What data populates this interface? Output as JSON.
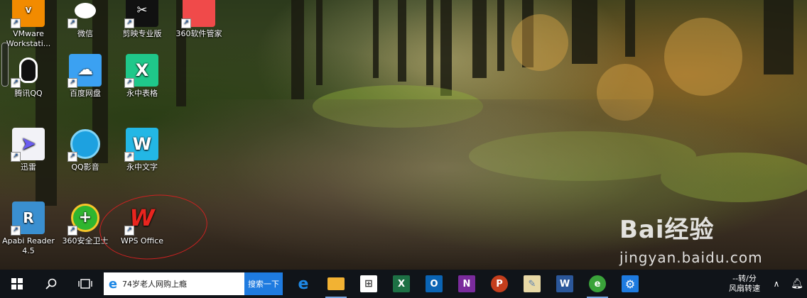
{
  "desktop_icons": [
    {
      "label": "VMware Workstati...",
      "icon": "vmware-icon"
    },
    {
      "label": "微信",
      "icon": "wechat-icon"
    },
    {
      "label": "剪映专业版",
      "icon": "jianying-icon"
    },
    {
      "label": "360软件管家",
      "icon": "360-software-manager-icon"
    },
    {
      "label": "腾讯QQ",
      "icon": "qq-icon"
    },
    {
      "label": "百度网盘",
      "icon": "baidu-netdisk-icon"
    },
    {
      "label": "永中表格",
      "icon": "yozo-sheet-icon"
    },
    {
      "label": "迅雷",
      "icon": "thunder-icon"
    },
    {
      "label": "QQ影音",
      "icon": "qq-player-icon"
    },
    {
      "label": "永中文字",
      "icon": "yozo-writer-icon"
    },
    {
      "label": "Apabi Reader 4.5",
      "icon": "apabi-reader-icon"
    },
    {
      "label": "360安全卫士",
      "icon": "360-security-icon"
    },
    {
      "label": "WPS Office",
      "icon": "wps-office-icon"
    }
  ],
  "watermark": {
    "brand": "Bai经验",
    "url": "jingyan.baidu.com"
  },
  "taskbar": {
    "search_text": "74岁老人网购上瘾",
    "search_button": "搜索一下",
    "apps": [
      {
        "name": "edge",
        "glyph": "e",
        "color": "#1e88e5"
      },
      {
        "name": "file-explorer",
        "glyph": "▭",
        "color": "#f2b233"
      },
      {
        "name": "store",
        "glyph": "⊞",
        "color": "#444"
      },
      {
        "name": "excel",
        "glyph": "X",
        "color": "#1d7044"
      },
      {
        "name": "outlook",
        "glyph": "O",
        "color": "#0a64b4"
      },
      {
        "name": "onenote",
        "glyph": "N",
        "color": "#7a2b9c"
      },
      {
        "name": "powerpoint",
        "glyph": "P",
        "color": "#c43e1c"
      },
      {
        "name": "paint",
        "glyph": "✎",
        "color": "#5a7fb0"
      },
      {
        "name": "word",
        "glyph": "W",
        "color": "#2b579a"
      },
      {
        "name": "browser-360",
        "glyph": "e",
        "color": "#3aa33a"
      },
      {
        "name": "settings",
        "glyph": "⚙",
        "color": "#1e7be0"
      }
    ],
    "tray": {
      "fan_speed": "--转/分",
      "fan_label": "风扇转速"
    }
  }
}
